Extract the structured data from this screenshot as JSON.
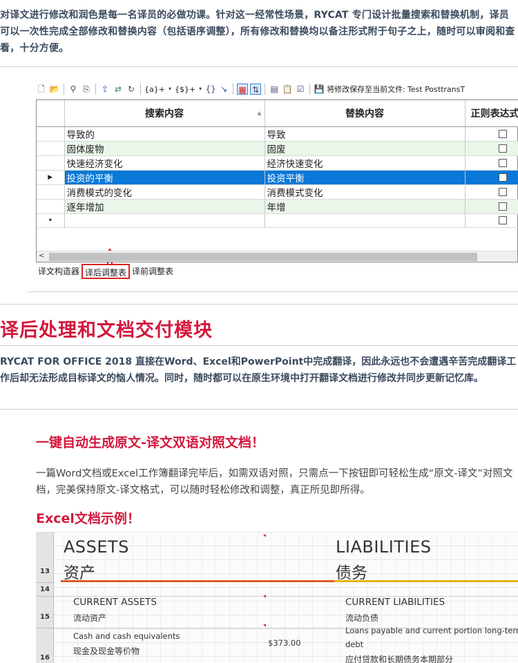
{
  "intro": {
    "text": "对译文进行修改和润色是每一名译员的必做功课。针对这一经常性场景，RYCAT 专门设计批量搜索和替换机制，译员可以一次性完成全部修改和替换内容（包括语序调整），所有修改和替换均以备注形式附于句子之上，随时可以审阅和查看，十分方便。"
  },
  "app": {
    "toolbar": {
      "save_label": "将修改保存至当前文件:",
      "file_label": "Test PosttransT",
      "regex_plus_label": "{a}+",
      "dollar_plus_label": "{$}+"
    },
    "columns": [
      "搜索内容",
      "替换内容",
      "正则表达式"
    ],
    "rows": [
      {
        "search": "导致的",
        "replace": "导致"
      },
      {
        "search": "固体废物",
        "replace": "固废"
      },
      {
        "search": "快速经济变化",
        "replace": "经济快速变化"
      },
      {
        "search": "投资的平衡",
        "replace": "投资平衡"
      },
      {
        "search": "消费模式的变化",
        "replace": "消费模式变化"
      },
      {
        "search": "逐年增加",
        "replace": "年增"
      }
    ],
    "selected_row": 3,
    "tabs": [
      "译文构造器",
      "译后调整表",
      "译前调整表"
    ],
    "active_tab": 1,
    "colors": {
      "selection": "#0a78d7",
      "alt_row": "#eaf6ea",
      "highlight": "#d9241c"
    }
  },
  "section": {
    "title": "译后处理和文档交付模块",
    "text": "RYCAT FOR OFFICE 2018 直接在Word、Excel和PowerPoint中完成翻译，因此永远也不会遭遇辛苦完成翻译工作后却无法形成目标译文的恼人情况。同时，随时都可以在原生环境中打开翻译文档进行修改并同步更新记忆库。"
  },
  "feature": {
    "title": "一键自动生成原文-译文双语对照文档！",
    "text": "一篇Word文档或Excel工作簿翻译完毕后，如需双语对照，只需点一下按钮即可轻松生成“原文-译文”对照文档，完美保持原文-译文格式，可以随时轻松修改和调整，真正所见即所得。",
    "example_title": "Excel文档示例！"
  },
  "excel": {
    "row_numbers": [
      "13",
      "14",
      "15",
      "16"
    ],
    "assets_en": "ASSETS",
    "assets_cn": "资产",
    "liabilities_en": "LIABILITIES",
    "liabilities_cn": "债务",
    "current_assets_en": "CURRENT ASSETS",
    "current_assets_cn": "流动资产",
    "current_liabilities_en": "CURRENT LIABILITIES",
    "current_liabilities_cn": "流动负债",
    "cash_en": "Cash and cash equivalents",
    "cash_cn": "现金及现金等价物",
    "cash_value": "$373.00",
    "loans_en": "Loans payable and current portion long-term",
    "loans_en2": "debt",
    "loans_cn": "应付贷款和长期债务本期部分"
  }
}
